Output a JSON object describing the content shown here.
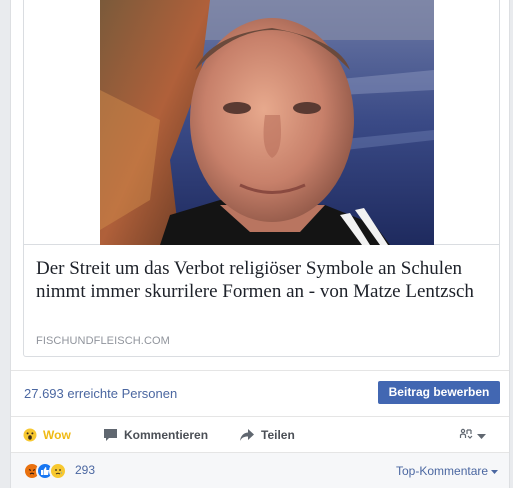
{
  "link_preview": {
    "headline": "Der Streit um das Verbot religiöser Symbole an Schulen nimmt immer skurrilere Formen an - von Matze Lentzsch",
    "domain": "FISCHUNDFLEISCH.COM"
  },
  "insights": {
    "reach_text": "27.693 erreichte Personen",
    "promote_label": "Beitrag bewerben"
  },
  "actions": {
    "wow_label": "Wow",
    "comment_label": "Kommentieren",
    "share_label": "Teilen",
    "audience_icon": "audience-selector-icon"
  },
  "reactions": {
    "icons": [
      "angry-icon",
      "like-icon",
      "sad-icon"
    ],
    "count": "293",
    "sort_label": "Top-Kommentare"
  },
  "colors": {
    "link_blue": "#4b67a1",
    "button_blue": "#4267b2",
    "wow_yellow": "#f0ba15"
  }
}
